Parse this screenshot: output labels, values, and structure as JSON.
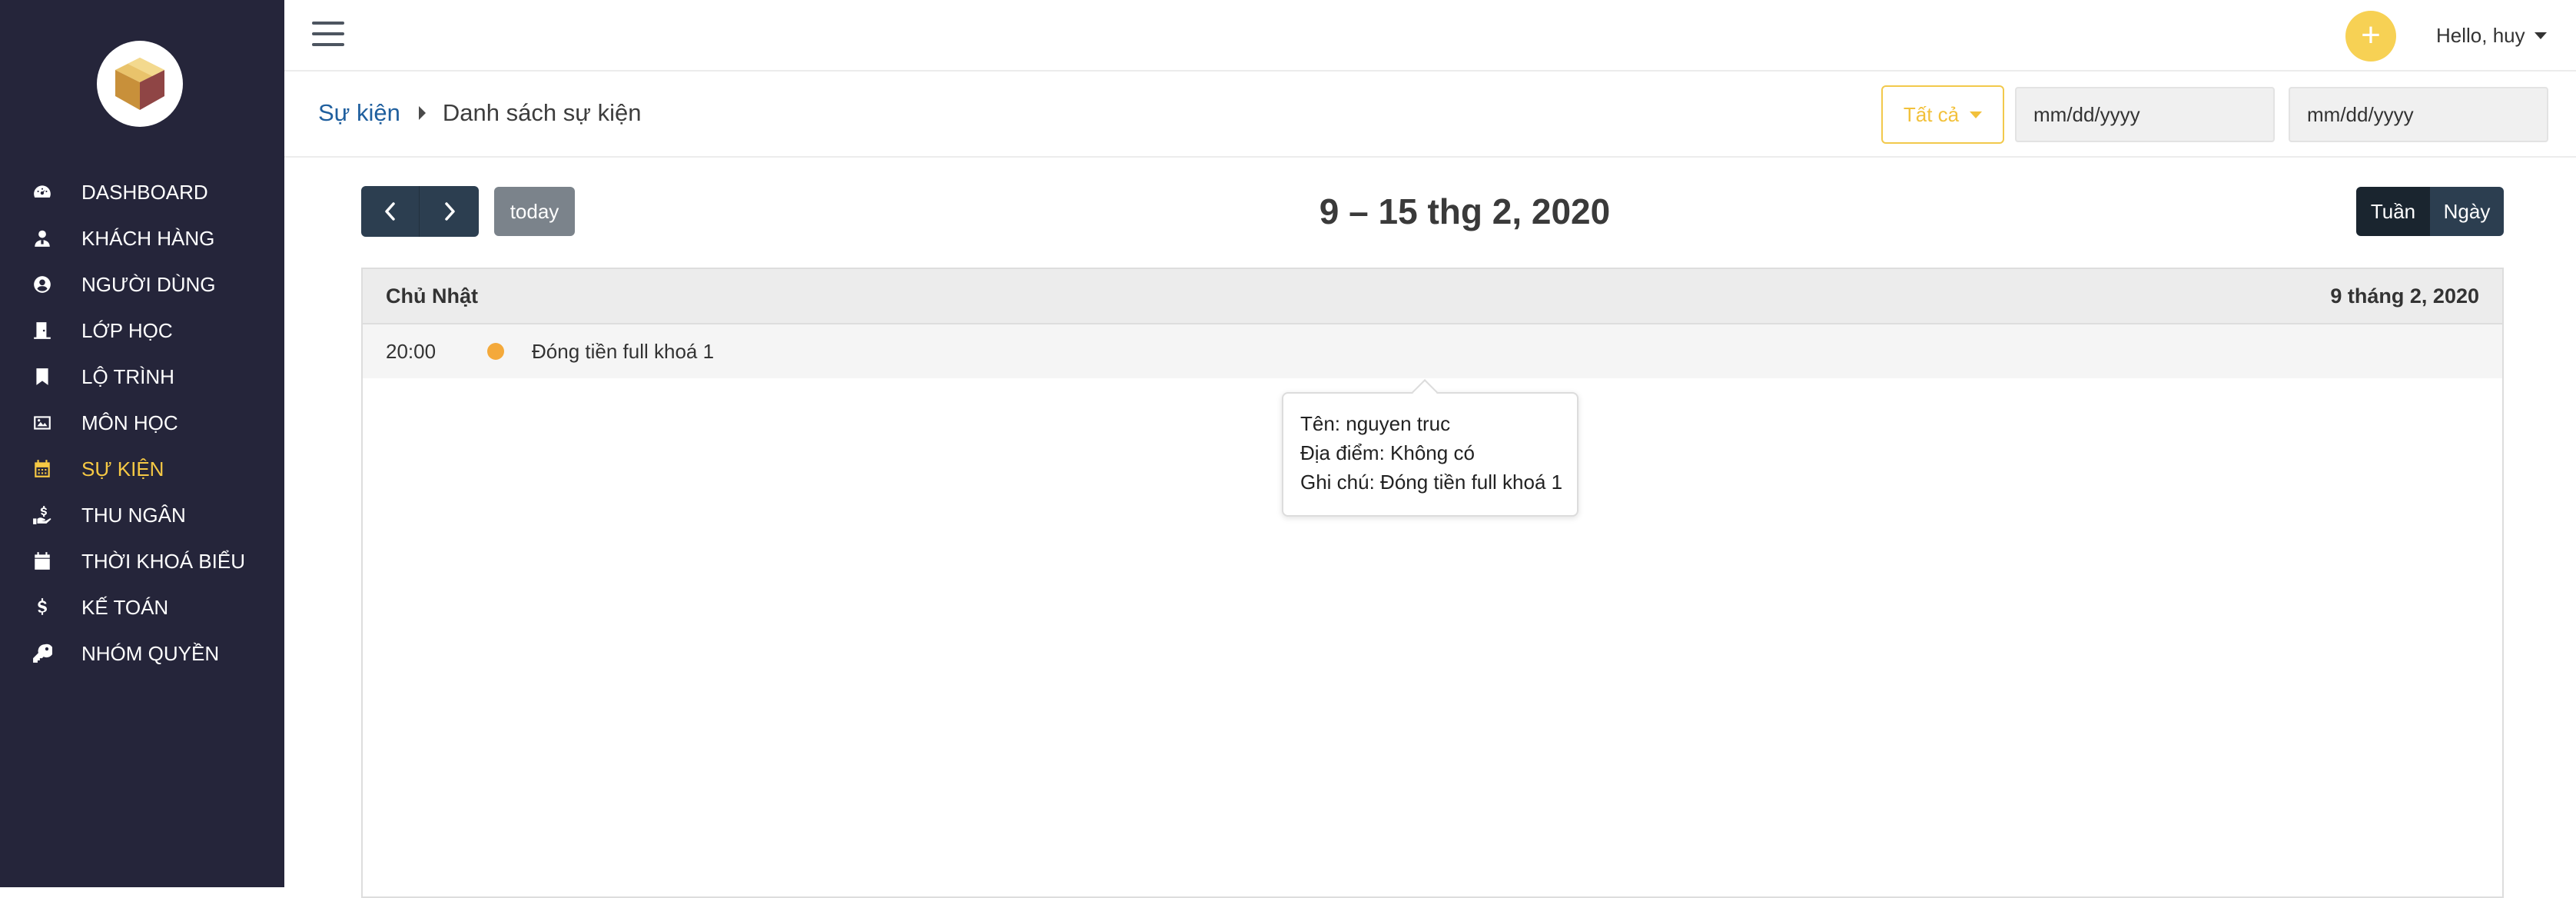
{
  "sidebar": {
    "items": [
      {
        "label": "DASHBOARD",
        "icon": "dashboard-icon"
      },
      {
        "label": "KHÁCH HÀNG",
        "icon": "customer-icon"
      },
      {
        "label": "NGƯỜI DÙNG",
        "icon": "user-circle-icon"
      },
      {
        "label": "LỚP HỌC",
        "icon": "door-icon"
      },
      {
        "label": "LỘ TRÌNH",
        "icon": "bookmark-icon"
      },
      {
        "label": "MÔN HỌC",
        "icon": "image-icon"
      },
      {
        "label": "SỰ KIỆN",
        "icon": "calendar-icon",
        "active": true
      },
      {
        "label": "THU NGÂN",
        "icon": "hand-holding-dollar-icon"
      },
      {
        "label": "THỜI KHOÁ BIỂU",
        "icon": "calendar-solid-icon"
      },
      {
        "label": "KẾ TOÁN",
        "icon": "dollar-icon"
      },
      {
        "label": "NHÓM QUYỀN",
        "icon": "key-icon"
      }
    ],
    "active_color": "#f6c944"
  },
  "header": {
    "add_button": "+",
    "user_greeting": "Hello, huy"
  },
  "breadcrumb": {
    "parent": "Sự kiện",
    "current": "Danh sách sự kiện"
  },
  "filters": {
    "category": "Tất cả",
    "date_from_placeholder": "mm/dd/yyyy",
    "date_to_placeholder": "mm/dd/yyyy"
  },
  "calendar": {
    "today_label": "today",
    "title": "9 – 15 thg 2, 2020",
    "view_week": "Tuần",
    "view_day": "Ngày",
    "active_view": "Tuần",
    "day": {
      "name": "Chủ Nhật",
      "date": "9 tháng 2, 2020"
    },
    "events": [
      {
        "time": "20:00",
        "title": "Đóng tiền full khoá 1",
        "color": "#f4a93a"
      }
    ]
  },
  "tooltip": {
    "name": "Tên: nguyen truc",
    "location": "Địa điểm: Không có",
    "note": "Ghi chú: Đóng tiền full khoá 1"
  }
}
